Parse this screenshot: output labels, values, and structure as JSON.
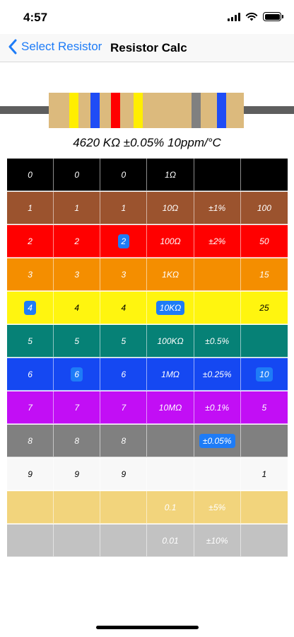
{
  "status": {
    "time": "4:57"
  },
  "nav": {
    "back_label": "Select Resistor",
    "title": "Resistor Calc"
  },
  "resistor": {
    "body_color": "#dcba7d",
    "lead_color": "#5e5e5e",
    "bands": [
      {
        "name": "digit1",
        "color": "#ffee00"
      },
      {
        "name": "digit2",
        "color": "#1f4cf5"
      },
      {
        "name": "digit3",
        "color": "#ff0000"
      },
      {
        "name": "multiplier",
        "color": "#ffee00"
      },
      {
        "name": "tolerance",
        "color": "#808080"
      },
      {
        "name": "tempco",
        "color": "#1f4cf5"
      }
    ]
  },
  "result_text": "4620 KΩ ±0.05% 10ppm/°C",
  "grid": {
    "rows": [
      {
        "color": "black",
        "bg": "#000000",
        "fg": "#ffffff",
        "cells": [
          "0",
          "0",
          "0",
          "1Ω",
          "",
          ""
        ]
      },
      {
        "color": "brown",
        "bg": "#9b532e",
        "fg": "#ffffff",
        "cells": [
          "1",
          "1",
          "1",
          "10Ω",
          "±1%",
          "100"
        ]
      },
      {
        "color": "red",
        "bg": "#ff0000",
        "fg": "#ffffff",
        "cells": [
          "2",
          "2",
          "2",
          "100Ω",
          "±2%",
          "50"
        ]
      },
      {
        "color": "orange",
        "bg": "#f48e00",
        "fg": "#ffffff",
        "cells": [
          "3",
          "3",
          "3",
          "1KΩ",
          "",
          "15"
        ]
      },
      {
        "color": "yellow",
        "bg": "#fff50f",
        "fg": "#000000",
        "cells": [
          "4",
          "4",
          "4",
          "10KΩ",
          "",
          "25"
        ]
      },
      {
        "color": "green",
        "bg": "#068176",
        "fg": "#ffffff",
        "cells": [
          "5",
          "5",
          "5",
          "100KΩ",
          "±0.5%",
          ""
        ]
      },
      {
        "color": "blue",
        "bg": "#1548f2",
        "fg": "#ffffff",
        "cells": [
          "6",
          "6",
          "6",
          "1MΩ",
          "±0.25%",
          "10"
        ]
      },
      {
        "color": "violet",
        "bg": "#c20ef5",
        "fg": "#ffffff",
        "cells": [
          "7",
          "7",
          "7",
          "10MΩ",
          "±0.1%",
          "5"
        ]
      },
      {
        "color": "grey",
        "bg": "#808080",
        "fg": "#ffffff",
        "cells": [
          "8",
          "8",
          "8",
          "",
          "±0.05%",
          ""
        ]
      },
      {
        "color": "white",
        "bg": "#f8f8f8",
        "fg": "#000000",
        "cells": [
          "9",
          "9",
          "9",
          "",
          "",
          "1"
        ]
      },
      {
        "color": "gold",
        "bg": "#f2d47c",
        "fg": "#ffffff",
        "cells": [
          "",
          "",
          "",
          "0.1",
          "±5%",
          ""
        ]
      },
      {
        "color": "silver",
        "bg": "#c2c2c2",
        "fg": "#ffffff",
        "cells": [
          "",
          "",
          "",
          "0.01",
          "±10%",
          ""
        ]
      }
    ],
    "selected": [
      {
        "row": 4,
        "col": 0
      },
      {
        "row": 6,
        "col": 1
      },
      {
        "row": 2,
        "col": 2
      },
      {
        "row": 4,
        "col": 3
      },
      {
        "row": 8,
        "col": 4
      },
      {
        "row": 6,
        "col": 5
      }
    ],
    "selection_color": "#1e7cf7"
  }
}
